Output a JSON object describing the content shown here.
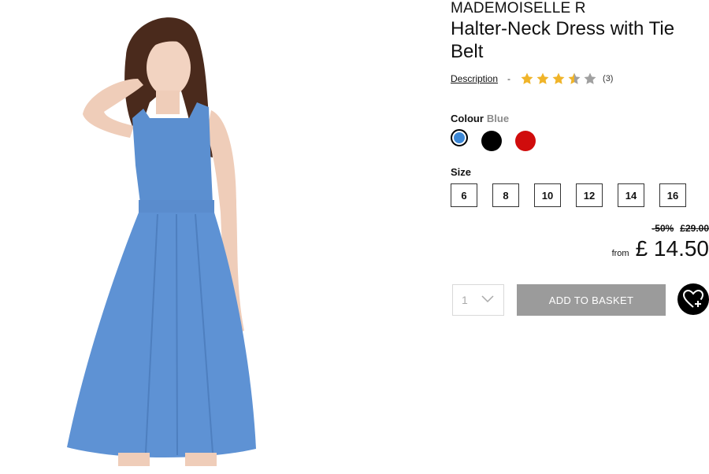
{
  "product": {
    "brand": "MADEMOISELLE R",
    "title": "Halter-Neck Dress with Tie Belt",
    "image_icon": "product-photo-blue-dress"
  },
  "reviews": {
    "description_label": "Description",
    "separator": "-",
    "rating": 3.5,
    "max_rating": 5,
    "count_label": "(3)",
    "star_color": "#f0b429",
    "star_empty_color": "#a0a0a0"
  },
  "colour": {
    "label": "Colour",
    "selected": "Blue",
    "options": [
      {
        "name": "blue-swatch",
        "color": "#3d88d6"
      },
      {
        "name": "black-swatch",
        "color": "#000000"
      },
      {
        "name": "red-swatch",
        "color": "#d00c0c"
      }
    ]
  },
  "size": {
    "label": "Size",
    "options": [
      "6",
      "8",
      "10",
      "12",
      "14",
      "16"
    ]
  },
  "pricing": {
    "discount": "-50%",
    "old_price": "£29.00",
    "from_label": "from",
    "price": "£ 14.50"
  },
  "purchase": {
    "quantity": "1",
    "add_label": "ADD TO BASKET",
    "button_color": "#9b9b9b",
    "wishlist_icon": "heart-plus-icon"
  }
}
